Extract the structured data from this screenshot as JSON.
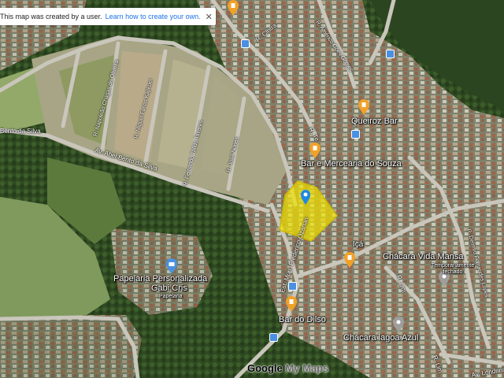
{
  "notice": {
    "text": "This map was created by a user.",
    "link": "Learn how to create your own."
  },
  "places": {
    "queiroz_bar": "Queiroz Bar",
    "bar_souza": "Bar e Mercearia do Souza",
    "ica": "Içá",
    "chacara_vida_mansa": "Chácara Vida Mansa",
    "chacara_status": "Temporariamente fechado",
    "papelaria_line1": "Papelaria Personalizada",
    "papelaria_line2": "Gabi Cris",
    "papelaria_sub": "Papelaria",
    "bar_dilso": "Bar do Dilso",
    "chacara_lagoa": "Chácara lagoa Azul"
  },
  "streets": {
    "bento_silva": "Bento da Silva",
    "abel_bento": "Av. Abel Bento da Silva",
    "napoleao": "R. Napoleão Chagas de Oliveira",
    "miguel": "R. Miguel Farias Kajikuer",
    "fernando": "R. Fernando Talido Tavares",
    "jose": "R. José Nunes",
    "cintra": "R. Cintra",
    "americo": "R. Américo Góes Gomes",
    "tenor": "R. Te",
    "frederico": "Est. Mun. Frederico Ozanan",
    "rlim1": "R. Lim",
    "rlim2": "R. Lim",
    "ruas": "R. Delmiro Fernandes Lopes",
    "londrina": "Av. Londrina"
  },
  "logo": {
    "google": "Google",
    "my_maps": " My Maps"
  },
  "colors": {
    "polygon_fill": "#f2e300",
    "polygon_stroke": "#c9b800",
    "pin_orange": "#f2a127",
    "pin_blue": "#4a90e2",
    "marker_blue": "#1e88e5"
  },
  "icons": {
    "bar_pin": "beer-glass-icon",
    "shop_pin": "shopping-bag-icon",
    "place_pin": "map-pin-icon",
    "bus_stop": "bus-stop-icon"
  }
}
